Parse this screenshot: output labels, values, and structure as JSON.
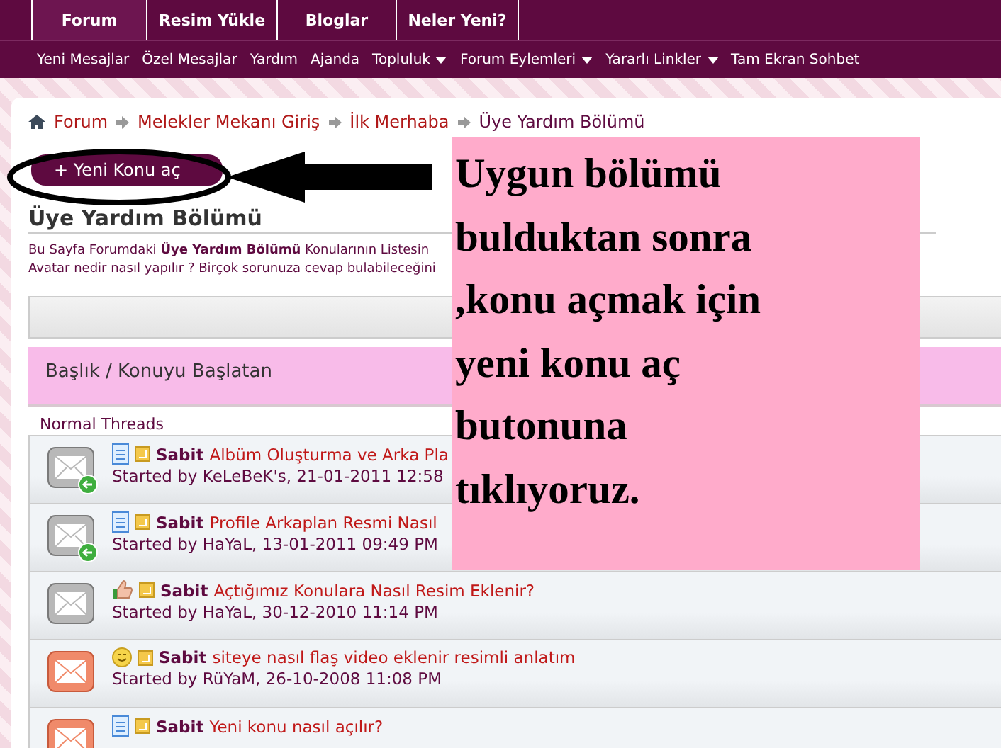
{
  "tabs": [
    {
      "label": "Forum",
      "selected": true
    },
    {
      "label": "Resim Yükle",
      "selected": false
    },
    {
      "label": "Bloglar",
      "selected": false
    },
    {
      "label": "Neler Yeni?",
      "selected": false
    }
  ],
  "submenu": [
    {
      "label": "Yeni Mesajlar",
      "has_menu": false
    },
    {
      "label": "Özel Mesajlar",
      "has_menu": false
    },
    {
      "label": "Yardım",
      "has_menu": false
    },
    {
      "label": "Ajanda",
      "has_menu": false
    },
    {
      "label": "Topluluk",
      "has_menu": true
    },
    {
      "label": "Forum Eylemleri",
      "has_menu": true
    },
    {
      "label": "Yararlı Linkler",
      "has_menu": true
    },
    {
      "label": "Tam Ekran Sohbet",
      "has_menu": false
    }
  ],
  "breadcrumb": [
    {
      "label": "Forum",
      "current": false
    },
    {
      "label": "Melekler Mekanı Giriş",
      "current": false
    },
    {
      "label": "İlk Merhaba",
      "current": false
    },
    {
      "label": "Üye Yardım Bölümü",
      "current": true
    }
  ],
  "new_thread_button": "+ Yeni Konu aç",
  "heading": "Üye Yardım Bölümü",
  "description": [
    "Bu Sayfa Forumdaki **Üye Yardım Bölümü** Konularının Listesin",
    "Avatar nedir nasıl yapılır ? Birçok sorunuza cevap bulabileceğini"
  ],
  "table_header": "Başlık / Konuyu Başlatan",
  "section_label": "Normal Threads",
  "threads": [
    {
      "hot": false,
      "posted_in": true,
      "kind": "document",
      "prefix": "Sabit",
      "title": "Albüm Oluşturma ve Arka Pla",
      "started": "Started by KeLeBeK's, 21-01-2011 12:58"
    },
    {
      "hot": false,
      "posted_in": true,
      "kind": "document",
      "prefix": "Sabit",
      "title": "Profile Arkaplan Resmi Nasıl",
      "started": "Started by HaYaL, 13-01-2011 09:49 PM"
    },
    {
      "hot": false,
      "posted_in": false,
      "kind": "thumbs",
      "prefix": "Sabit",
      "title": "Açtığımız Konulara Nasıl Resim Eklenir?",
      "started": "Started by HaYaL, 30-12-2010 11:14 PM"
    },
    {
      "hot": true,
      "posted_in": false,
      "kind": "smiley",
      "prefix": "Sabit",
      "title": "siteye nasıl flaş video eklenir resimli anlatım",
      "started": "Started by RüYaM, 26-10-2008 11:08 PM"
    },
    {
      "hot": true,
      "posted_in": false,
      "kind": "document",
      "prefix": "Sabit",
      "title": "Yeni konu nasıl açılır?"
    }
  ],
  "annotation": [
    "Uygun bölümü",
    "bulduktan sonra",
    ",konu açmak için",
    "yeni konu aç",
    "butonuna",
    "tıklıyoruz."
  ]
}
